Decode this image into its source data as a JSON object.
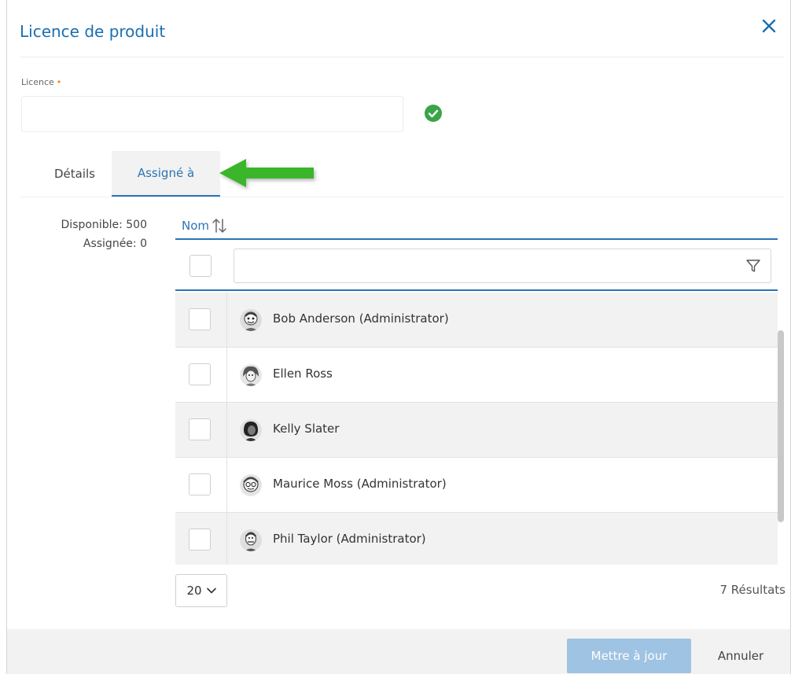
{
  "dialog": {
    "title": "Licence de produit",
    "close_icon": "close-icon"
  },
  "license": {
    "label": "Licence",
    "required_marker": "•",
    "value": "",
    "status_icon": "check-circle-icon"
  },
  "tabs": [
    {
      "label": "Détails",
      "active": false
    },
    {
      "label": "Assigné à",
      "active": true
    }
  ],
  "summary": {
    "available": "Disponible: 500",
    "assigned": "Assignée: 0"
  },
  "grid": {
    "column_header": "Nom",
    "sort_icon": "sort-arrows-icon",
    "filter_value": "",
    "filter_icon": "filter-icon",
    "rows": [
      {
        "name": "Bob Anderson (Administrator)",
        "avatar": "avatar-icon"
      },
      {
        "name": "Ellen Ross",
        "avatar": "avatar-icon"
      },
      {
        "name": "Kelly Slater",
        "avatar": "avatar-icon"
      },
      {
        "name": "Maurice Moss (Administrator)",
        "avatar": "avatar-icon"
      },
      {
        "name": "Phil Taylor (Administrator)",
        "avatar": "avatar-icon"
      }
    ]
  },
  "pager": {
    "page_size": "20",
    "results": "7 Résultats"
  },
  "footer": {
    "update_label": "Mettre à jour",
    "cancel_label": "Annuler"
  },
  "colors": {
    "accent": "#2a74b5",
    "title": "#1a6fb0",
    "success": "#3aa448",
    "annotation_arrow": "#3bb52a",
    "required": "#f07c1a",
    "button_disabled": "#9fc3e2"
  }
}
